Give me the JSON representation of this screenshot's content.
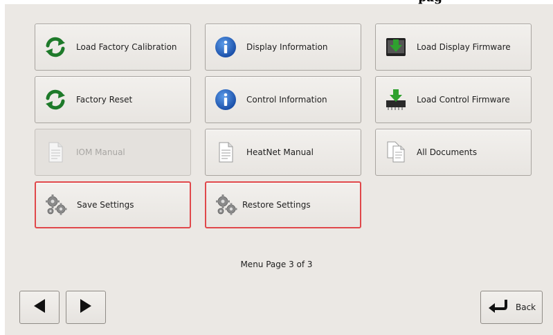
{
  "header": {
    "partial_text": "pag"
  },
  "menu": {
    "buttons": [
      {
        "label": "Load Factory Calibration",
        "icon": "refresh-icon",
        "enabled": true
      },
      {
        "label": "Display Information",
        "icon": "info-icon",
        "enabled": true
      },
      {
        "label": "Load Display Firmware",
        "icon": "display-firmware-icon",
        "enabled": true
      },
      {
        "label": "Factory Reset",
        "icon": "refresh-icon",
        "enabled": true
      },
      {
        "label": "Control Information",
        "icon": "info-icon",
        "enabled": true
      },
      {
        "label": "Load Control Firmware",
        "icon": "chip-firmware-icon",
        "enabled": true
      },
      {
        "label": "IOM Manual",
        "icon": "document-icon",
        "enabled": false
      },
      {
        "label": "HeatNet Manual",
        "icon": "document-icon",
        "enabled": true
      },
      {
        "label": "All Documents",
        "icon": "documents-icon",
        "enabled": true
      },
      {
        "label": "Save Settings",
        "icon": "gears-icon",
        "enabled": true,
        "highlighted": true
      },
      {
        "label": "Restore Settings",
        "icon": "gears-icon",
        "enabled": true,
        "highlighted": true
      }
    ]
  },
  "footer": {
    "page_label": "Menu Page 3 of 3",
    "back_label": "Back"
  },
  "colors": {
    "panel_bg": "#ebe8e4",
    "highlight_border": "#e0474a",
    "refresh_green": "#1e7a2a",
    "info_blue": "#1f5fbf",
    "arrow_green": "#2fa12f"
  }
}
